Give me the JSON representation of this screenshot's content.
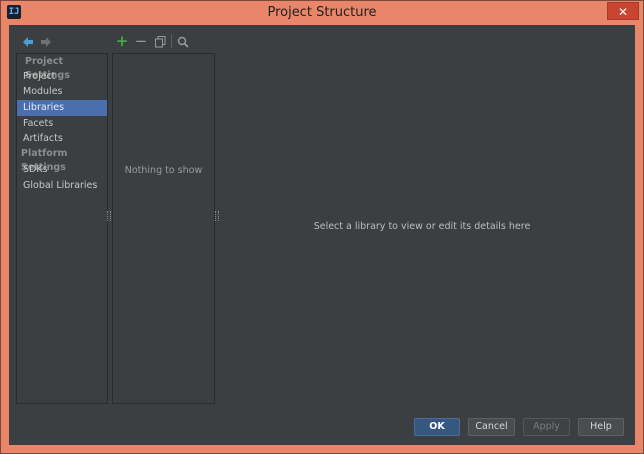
{
  "window": {
    "title": "Project Structure",
    "close_glyph": "✕"
  },
  "toolbar": {
    "back_icon": "back-arrow-icon",
    "forward_icon": "forward-arrow-icon",
    "add_glyph": "+",
    "remove_glyph": "−",
    "copy_icon": "copy-icon",
    "search_icon": "search-icon"
  },
  "sidebar": {
    "project_settings_header": "Project Settings",
    "items_project": [
      {
        "label": "Project"
      },
      {
        "label": "Modules"
      },
      {
        "label": "Libraries",
        "selected": true
      },
      {
        "label": "Facets"
      },
      {
        "label": "Artifacts"
      }
    ],
    "platform_settings_header": "Platform Settings",
    "items_platform": [
      {
        "label": "SDKs"
      },
      {
        "label": "Global Libraries"
      }
    ]
  },
  "list": {
    "empty_text": "Nothing to show"
  },
  "details": {
    "placeholder": "Select a library to view or edit its details here"
  },
  "buttons": {
    "ok": "OK",
    "cancel": "Cancel",
    "apply": "Apply",
    "help": "Help"
  },
  "colors": {
    "titlebar": "#e9866a",
    "background": "#3c3f41",
    "selection": "#4b6eaf",
    "add_green": "#4aa64a",
    "nav_arrow_blue": "#4a9fd8"
  }
}
